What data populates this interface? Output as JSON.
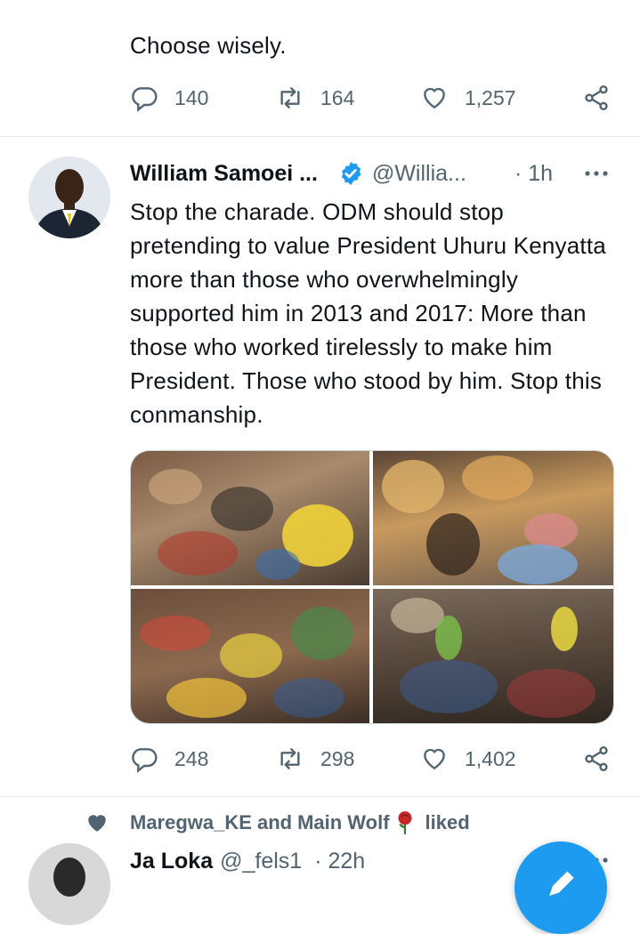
{
  "prev_tweet": {
    "text": "Choose wisely.",
    "replies": "140",
    "retweets": "164",
    "likes": "1,257"
  },
  "tweet": {
    "author": "William Samoei ...",
    "handle": "@Willia...",
    "time": "· 1h",
    "text": "Stop the charade. ODM should stop pretending to value President Uhuru Kenyatta more than those who overwhelmingly supported him in 2013 and 2017: More than those who worked tirelessly to make him President. Those who stood by him. Stop this conmanship.",
    "replies": "248",
    "retweets": "298",
    "likes": "1,402",
    "verified": true,
    "media_count": 4
  },
  "next_tweet": {
    "liked_by_1": "Maregwa_KE",
    "liked_by_and": "and",
    "liked_by_2": "Main Wolf",
    "liked_suffix": "liked",
    "author": "Ja Loka",
    "handle": "@_fels1",
    "time": "· 22h"
  },
  "colors": {
    "accent": "#1d9bf0",
    "text": "#0f1419",
    "secondary": "#536471"
  }
}
